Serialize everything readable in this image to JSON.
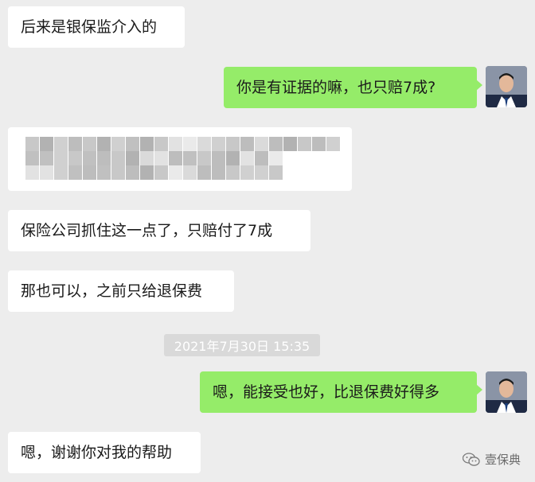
{
  "messages": [
    {
      "side": "in",
      "text": "后来是银保监介入的"
    },
    {
      "side": "out",
      "text": "你是有证据的嘛，也只赔7成?"
    },
    {
      "side": "in",
      "text": "保险公司抓住这一点了，只赔付了7成"
    },
    {
      "side": "in",
      "text": "那也可以，之前只给退保费"
    },
    {
      "side": "out",
      "text": "嗯，能接受也好，比退保费好得多"
    },
    {
      "side": "in",
      "text": "嗯，谢谢你对我的帮助"
    }
  ],
  "timestamp": "2021年7月30日 15:35",
  "watermark": {
    "icon": "wechat-icon",
    "text": "壹保典"
  },
  "colors": {
    "background": "#ededed",
    "incoming": "#ffffff",
    "outgoing": "#95ec69",
    "timestamp_bg": "#d9d9d9"
  }
}
